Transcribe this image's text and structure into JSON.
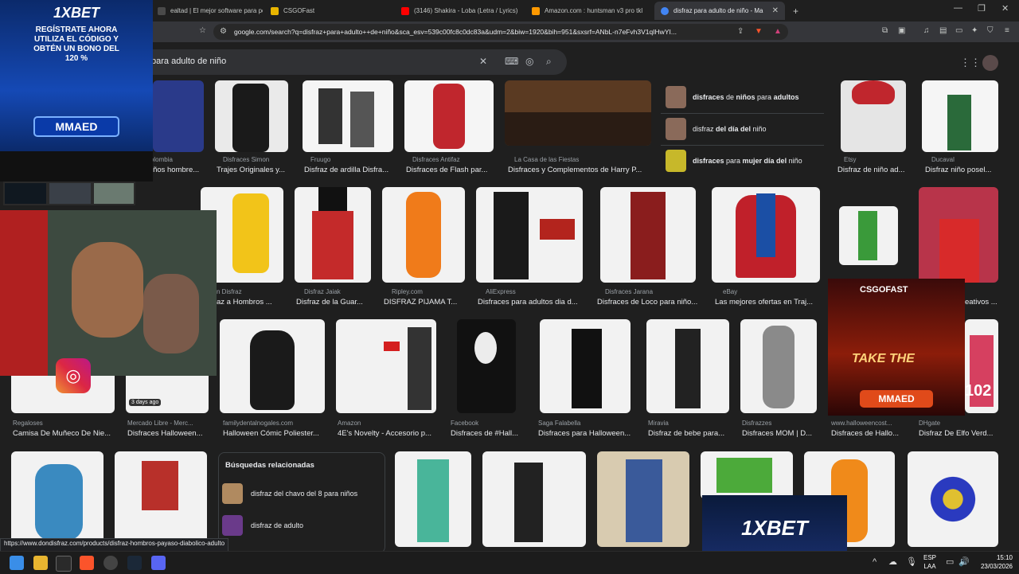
{
  "browser": {
    "tabs": [
      {
        "label": "ealtad | El mejor software para pote",
        "color": "#4a4a4a"
      },
      {
        "label": "CSGOFast",
        "color": "#e8b500"
      },
      {
        "label": "(3146) Shakira - Loba (Letra / Lyrics)",
        "color": "#ff0000"
      },
      {
        "label": "Amazon.com : huntsman v3 pro tkl",
        "color": "#ff9900"
      },
      {
        "label": "disfraz para adulto de niño - Ma",
        "color": "#4285f4"
      }
    ],
    "new_tab": "+",
    "url": "google.com/search?q=disfraz+para+adulto++de+niño&sca_esv=539c00fc8c0dc83a&udm=2&biw=1920&bih=951&sxsrf=ANbL-n7eFvh3V1qIHwYI...",
    "window_controls": [
      "—",
      "❐",
      "✕"
    ]
  },
  "search": {
    "query": "para adulto de niño"
  },
  "suggestions": [
    {
      "parts": [
        [
          "disfraces",
          "b"
        ],
        [
          " de ",
          ""
        ],
        [
          "niños",
          "b"
        ],
        [
          " para ",
          ""
        ],
        [
          "adultos",
          "b"
        ]
      ]
    },
    {
      "parts": [
        [
          "disfraz ",
          ""
        ],
        [
          "del día del",
          ""
        ],
        [
          " niño",
          ""
        ]
      ]
    },
    {
      "parts": [
        [
          "disfraces",
          "b"
        ],
        [
          " para ",
          ""
        ],
        [
          "mujer día del",
          ""
        ],
        [
          " niño",
          ""
        ]
      ]
    }
  ],
  "row1": [
    {
      "src": "ee Colombia",
      "title": "es niños hombre..."
    },
    {
      "src": "Disfraces Simon",
      "title": "Trajes Originales y..."
    },
    {
      "src": "Fruugo",
      "title": "Disfraz de ardilla Disfra..."
    },
    {
      "src": "Disfraces Antifaz",
      "title": "Disfraces de Flash par..."
    },
    {
      "src": "La Casa de las Fiestas",
      "title": "Disfraces y Complementos de Harry P..."
    },
    {
      "src": "Etsy",
      "title": "Disfraz de niño ad..."
    },
    {
      "src": "Ducaval",
      "title": "Disfraz niño posel..."
    }
  ],
  "row2": [
    {
      "src": "n Disfraz",
      "title": "az a Hombros ..."
    },
    {
      "src": "Disfraz Jaiak",
      "title": "Disfraz de la Guar..."
    },
    {
      "src": "Ripley.com",
      "title": "DISFRAZ PIJAMA T..."
    },
    {
      "src": "AliExpress",
      "title": "Disfraces para adultos dia d..."
    },
    {
      "src": "Disfraces Jarana",
      "title": "Disfraces de Loco para niño..."
    },
    {
      "src": "eBay",
      "title": "Las mejores ofertas en Traj..."
    },
    {
      "src": "",
      "title": "eativos ..."
    }
  ],
  "row3": [
    {
      "src": "Regaloses",
      "title": "Camisa De Muñeco De Nie..."
    },
    {
      "src": "Mercado Libre - Merc...",
      "title": "Disfraces Halloween..."
    },
    {
      "src": "familydentalnogales.com",
      "title": "Halloween Cómic Poliester..."
    },
    {
      "src": "Amazon",
      "title": "4E's Novelty - Accesorio p..."
    },
    {
      "src": "Facebook",
      "title": "Disfraces de #Hall..."
    },
    {
      "src": "Saga Falabella",
      "title": "Disfraces para Halloween..."
    },
    {
      "src": "Miravia",
      "title": "Disfraz de bebe para..."
    },
    {
      "src": "Disfrazzes",
      "title": "Disfraces MOM | D..."
    },
    {
      "src": "www.halloweencost...",
      "title": "Disfraces de Hallo..."
    },
    {
      "src": "DHgate",
      "title": "Disfraz De Elfo Verd..."
    }
  ],
  "badge_days_ago": "3 days ago",
  "related": {
    "heading": "Búsquedas relacionadas",
    "items": [
      "disfraz del chavo del 8 para niños",
      "disfraz de adulto"
    ]
  },
  "overlays": {
    "ad_top_brand": "1XBET",
    "ad_top_text": "REGÍSTRATE AHORA UTILIZA EL CÓDIGO Y OBTÉN UN BONO DEL 120 %",
    "ad_top_code": "MMAED",
    "cgso_brand": "CSGOFAST",
    "cgso_tag": "TAKE THE",
    "cgso_code": "MMAED",
    "cgso_count": "102",
    "ad_bottom_brand": "1XBET"
  },
  "status_url": "https://www.dondisfraz.com/products/disfraz-hombros-payaso-diabolico-adulto",
  "taskbar": {
    "lang": "ESP",
    "lang2": "LAA",
    "time": "15:10",
    "date": "23/03/2026"
  },
  "colors": {
    "bg": "#1f1f1f",
    "accent": "#8ab4f8"
  }
}
